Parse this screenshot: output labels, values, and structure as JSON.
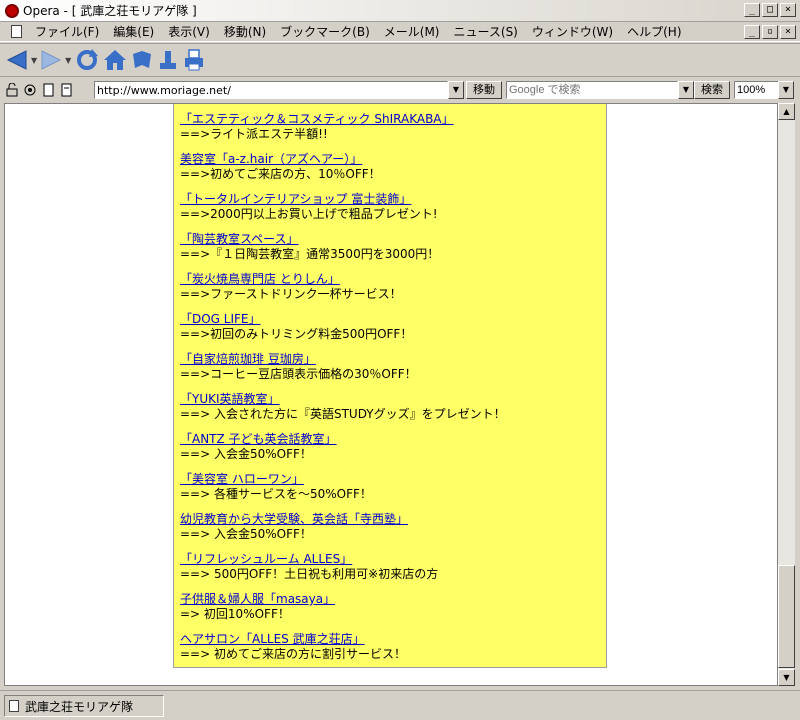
{
  "window": {
    "title": "Opera - [ 武庫之荘モリアゲ隊 ]"
  },
  "menu": {
    "items": [
      "ファイル(F)",
      "編集(E)",
      "表示(V)",
      "移動(N)",
      "ブックマーク(B)",
      "メール(M)",
      "ニュース(S)",
      "ウィンドウ(W)",
      "ヘルプ(H)"
    ]
  },
  "address": {
    "url": "http://www.moriage.net/",
    "go_label": "移動",
    "search_placeholder": "Google で検索",
    "search_label": "検索",
    "zoom": "100%"
  },
  "entries": [
    {
      "name": "「エステティック＆コスメティック ShIRAKABA」",
      "desc": "==>ライト派エステ半額!!"
    },
    {
      "name": "美容室「a-z.hair（アズヘアー）」",
      "desc": "==>初めてご来店の方、10％OFF！"
    },
    {
      "name": "「トータルインテリアショップ 富士装飾」",
      "desc": "==>2000円以上お買い上げで粗品プレゼント!"
    },
    {
      "name": "「陶芸教室スペース」",
      "desc": "==>『１日陶芸教室』通常3500円を3000円！"
    },
    {
      "name": "「炭火焼鳥専門店 とりしん」",
      "desc": "==>ファーストドリンク一杯サービス！"
    },
    {
      "name": "「DOG LIFE」",
      "desc": "==>初回のみトリミング料金500円OFF！"
    },
    {
      "name": "「自家焙煎珈琲 豆珈房」",
      "desc": "==>コーヒー豆店頭表示価格の30％OFF！"
    },
    {
      "name": "「YUKI英語教室」",
      "desc": "==> 入会された方に『英語STUDYグッズ』をプレゼント！"
    },
    {
      "name": "「ANTZ 子ども英会話教室」",
      "desc": "==> 入会金50%OFF！"
    },
    {
      "name": "「美容室 ハローワン」",
      "desc": "==> 各種サービスを～50%OFF！"
    },
    {
      "name": "幼児教育から大学受験、英会話「寺西塾」",
      "desc": "==> 入会金50%OFF！"
    },
    {
      "name": "「リフレッシュルーム ALLES」",
      "desc": "==> 500円OFF！土日祝も利用可※初来店の方"
    },
    {
      "name": "子供服＆婦人服「masaya」",
      "desc": "=> 初回10%OFF！"
    },
    {
      "name": "ヘアサロン「ALLES 武庫之荘店」",
      "desc": "==> 初めてご来店の方に割引サービス！"
    }
  ],
  "status": {
    "text": "武庫之荘モリアゲ隊"
  },
  "colors": {
    "page_bg": "#ffff66",
    "link": "#0000cc",
    "chrome": "#d4d0c8",
    "back_arrow": "#3a6fc8"
  },
  "icons": [
    "opera-logo-icon",
    "back-icon",
    "forward-icon",
    "reload-icon",
    "home-icon",
    "hotlist-icon",
    "print-icon",
    "document-icon"
  ]
}
